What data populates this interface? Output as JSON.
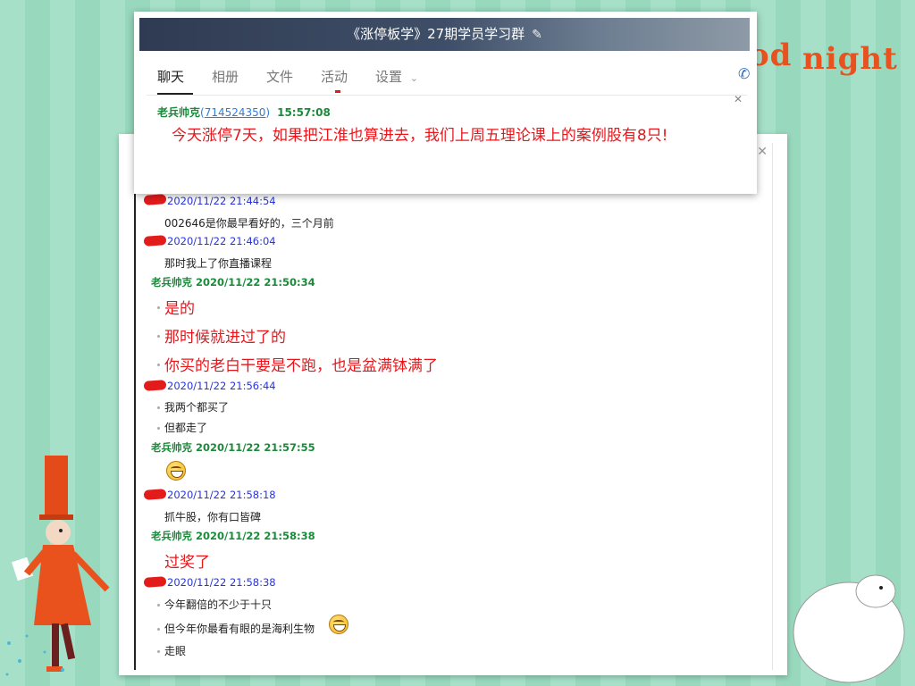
{
  "background": {
    "decor_text": [
      "od",
      "night"
    ],
    "colors": {
      "stripe_a": "#a6e0c8",
      "stripe_b": "#98d8bd",
      "accent": "#e8521e"
    }
  },
  "top_window": {
    "title": "《涨停板学》27期学员学习群",
    "tabs": [
      {
        "label": "聊天",
        "active": true
      },
      {
        "label": "相册",
        "active": false
      },
      {
        "label": "文件",
        "active": false
      },
      {
        "label": "活动",
        "active": false
      },
      {
        "label": "设置",
        "active": false
      }
    ],
    "message": {
      "sender": "老兵帅克",
      "qq": "714524350",
      "time": "15:57:08",
      "text": "今天涨停7天，如果把江淮也算进去，我们上周五理论课上的案例股有8只!"
    }
  },
  "log": {
    "entries": [
      {
        "sender": "",
        "timestamp": "2020/11/22 21:44:54",
        "lines": [
          "002646是你最早看好的，三个月前"
        ]
      },
      {
        "sender": "",
        "timestamp": "2020/11/22 21:46:04",
        "lines": [
          "那时我上了你直播课程"
        ]
      },
      {
        "sender": "老兵帅克",
        "timestamp": "2020/11/22 21:50:34",
        "lines": [
          "是的",
          "那时候就进过了的",
          "你买的老白干要是不跑，也是盆满钵满了"
        ]
      },
      {
        "sender": "",
        "timestamp": "2020/11/22 21:56:44",
        "lines": [
          "我两个都买了",
          "但都走了"
        ]
      },
      {
        "sender": "老兵帅克",
        "timestamp": "2020/11/22 21:57:55",
        "lines": []
      },
      {
        "sender": "",
        "timestamp": "2020/11/22 21:58:18",
        "lines": [
          "抓牛股，你有口皆碑"
        ]
      },
      {
        "sender": "老兵帅克",
        "timestamp": "2020/11/22 21:58:38",
        "lines": [
          "过奖了"
        ]
      },
      {
        "sender": "",
        "timestamp": "2020/11/22 21:58:38",
        "lines": [
          "今年翻倍的不少于十只",
          "但今年你最看有眼的是海利生物",
          "走眼"
        ]
      }
    ]
  }
}
